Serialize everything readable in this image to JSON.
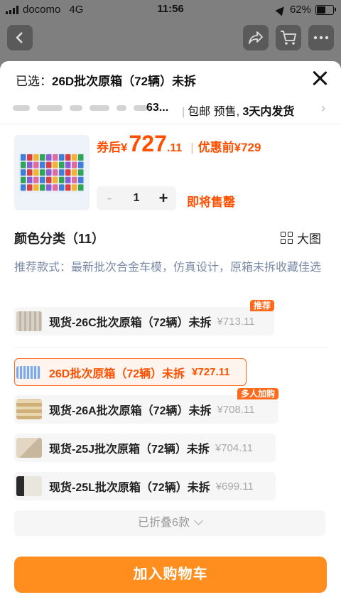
{
  "status_bar": {
    "carrier": "docomo",
    "network": "4G",
    "time": "11:56",
    "battery": "62%",
    "battery_level": 0.62
  },
  "header": {
    "back_icon": "chevron-left-icon",
    "share_icon": "share-icon",
    "cart_icon": "cart-icon",
    "more_icon": "more-icon"
  },
  "sheet": {
    "selected_prefix": "已选：",
    "selected_value": "26D批次原箱（72辆）未拆",
    "shipping": {
      "obscured_end": "63...",
      "free_shipping": "包邮",
      "presale": "预售,",
      "delivery_days": "3天内发货"
    },
    "price": {
      "label": "券后",
      "currency": "¥",
      "integer": "727",
      "decimal": ".11",
      "original": "优惠前¥729"
    },
    "quantity": {
      "value": "1",
      "minus": "-",
      "plus": "+"
    },
    "stock_status": "即将售罄",
    "section_title": "颜色分类（11）",
    "large_view": "大图",
    "recommend": "推荐款式：最新批次合金车模，仿真设计，原箱未拆收藏佳选",
    "options": [
      {
        "name": "现货-26C批次原箱（72辆）未拆",
        "price": "¥713.11",
        "tag": "推荐",
        "selected": false
      },
      {
        "name": "26D批次原箱（72辆）未拆",
        "price": "¥727.11",
        "tag": "",
        "selected": true
      },
      {
        "name": "现货-26A批次原箱（72辆）未拆",
        "price": "¥708.11",
        "tag": "多人加购",
        "selected": false
      },
      {
        "name": "现货-25J批次原箱（72辆）未拆",
        "price": "¥704.11",
        "tag": "",
        "selected": false
      },
      {
        "name": "现货-25L批次原箱（72辆）未拆",
        "price": "¥699.11",
        "tag": "",
        "selected": false
      }
    ],
    "folded": "已折叠6款",
    "add_to_cart": "加入购物车"
  },
  "colors": {
    "accent": "#ff5000",
    "button": "#ff8e1e",
    "selected_bg": "#fff4ee"
  }
}
